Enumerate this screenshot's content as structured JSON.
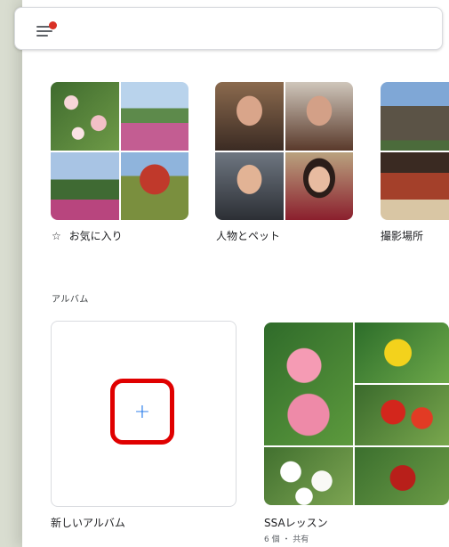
{
  "header": {
    "menu_icon": "menu-icon",
    "notification_color": "#d93025"
  },
  "explore": {
    "favorites_label": "お気に入り",
    "favorites_icon": "star-outline-icon",
    "people_label": "人物とペット",
    "places_label": "撮影場所"
  },
  "albums": {
    "section_label": "アルバム",
    "new_album_label": "新しいアルバム",
    "new_album_icon": "plus-icon",
    "plus_glyph": "+",
    "items": [
      {
        "title": "SSAレッスン",
        "subtitle": "6 個 ・ 共有"
      }
    ]
  },
  "colors": {
    "accent": "#1a73e8",
    "highlight_box": "#e00000"
  }
}
